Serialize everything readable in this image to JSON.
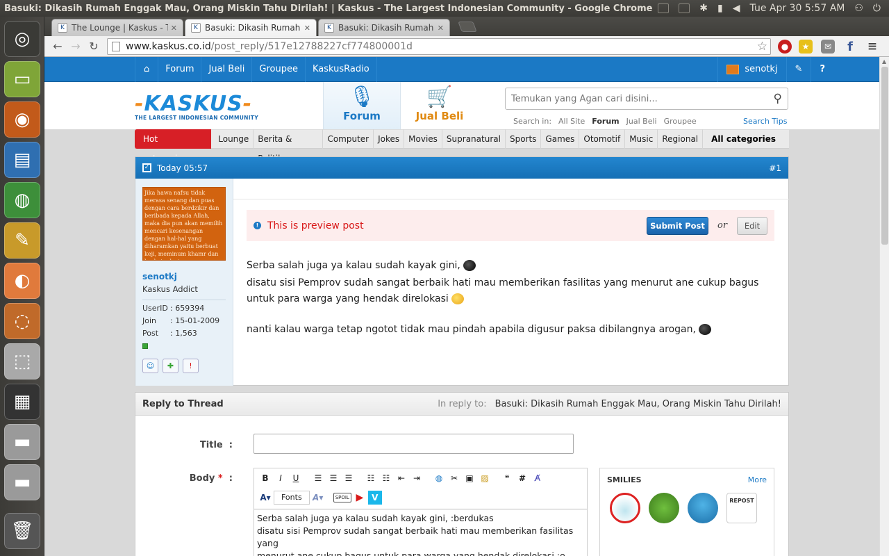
{
  "os": {
    "window_title": "Basuki: Dikasih Rumah Enggak Mau, Orang Miskin Tahu Dirilah! | Kaskus - The Largest Indonesian Community - Google Chrome",
    "clock": "Tue Apr 30  5:57 AM"
  },
  "browser": {
    "tabs": [
      {
        "title": "The Lounge | Kaskus - The"
      },
      {
        "title": "Basuki: Dikasih Rumah Eng"
      },
      {
        "title": "Basuki: Dikasih Rumah Eng"
      }
    ],
    "url_host": "www.kaskus.co.id",
    "url_path": "/post_reply/517e12788227cf774800001d"
  },
  "kaskus": {
    "nav": [
      "Forum",
      "Jual Beli",
      "Groupee",
      "KaskusRadio"
    ],
    "username": "senotkj",
    "logo_text": "KASKUS",
    "logo_tagline": "THE LARGEST INDONESIAN COMMUNITY",
    "bigtabs": {
      "forum": "Forum",
      "jualbeli": "Jual Beli"
    },
    "search": {
      "placeholder": "Temukan yang Agan cari disini...",
      "search_in_label": "Search in:",
      "scopes": [
        "All Site",
        "Forum",
        "Jual Beli",
        "Groupee"
      ],
      "tips": "Search Tips"
    },
    "categories": {
      "hot": "Hot categories",
      "items": [
        "Lounge",
        "Berita & Politik",
        "Computer",
        "Jokes",
        "Movies",
        "Supranatural",
        "Sports",
        "Games",
        "Otomotif",
        "Music",
        "Regional"
      ],
      "all": "All categories"
    }
  },
  "post": {
    "time": "Today 05:57",
    "number": "#1",
    "avatar_text": "Jika hawa nafsu tidak merasa senang dan puas dengan cara berdzikir dan beribada kepada Allah, maka dia pun akan memilih mencari kesenangan dengan hal-hal yang diharamkan yaitu berbuat keji, meminum khamr dan berkata dusta",
    "user": {
      "name": "senotkj",
      "rank": "Kaskus Addict",
      "stats": [
        {
          "k": "UserID",
          "v": ": 659394"
        },
        {
          "k": "Join",
          "v": ": 15-01-2009"
        },
        {
          "k": "Post",
          "v": ": 1,563"
        }
      ]
    },
    "preview_msg": "This is preview post",
    "submit_label": "Submit Post",
    "or_label": "or",
    "edit_label": "Edit",
    "lines": [
      "Serba salah juga ya kalau sudah kayak gini,",
      "disatu sisi Pemprov sudah sangat berbaik hati mau memberikan fasilitas yang menurut ane cukup bagus untuk para warga yang hendak direlokasi",
      "nanti kalau warga tetap ngotot tidak mau pindah apabila digusur paksa dibilangnya arogan,"
    ]
  },
  "reply": {
    "heading": "Reply to Thread",
    "in_reply_label": "In reply to:",
    "thread_title": "Basuki: Dikasih Rumah Enggak Mau, Orang Miskin Tahu Dirilah!",
    "title_label": "Title",
    "body_label": "Body",
    "colon": ":",
    "required_mark": "*",
    "fonts_label": "Fonts",
    "spoil_label": "SPOIL",
    "body_text": "Serba salah juga ya kalau sudah kayak gini, :berdukas\ndisatu sisi Pemprov sudah sangat berbaik hati mau memberikan fasilitas yang\nmenurut ane cukup bagus untuk para warga yang hendak direlokasi :o",
    "smilies_title": "SMILIES",
    "smilies_more": "More",
    "smiley_repost": "REPOST"
  },
  "colors": {
    "kaskus_blue": "#1b79c5",
    "hot_red": "#d71f26",
    "jualbeli_orange": "#e08a12",
    "preview_red": "#d91a1a"
  }
}
